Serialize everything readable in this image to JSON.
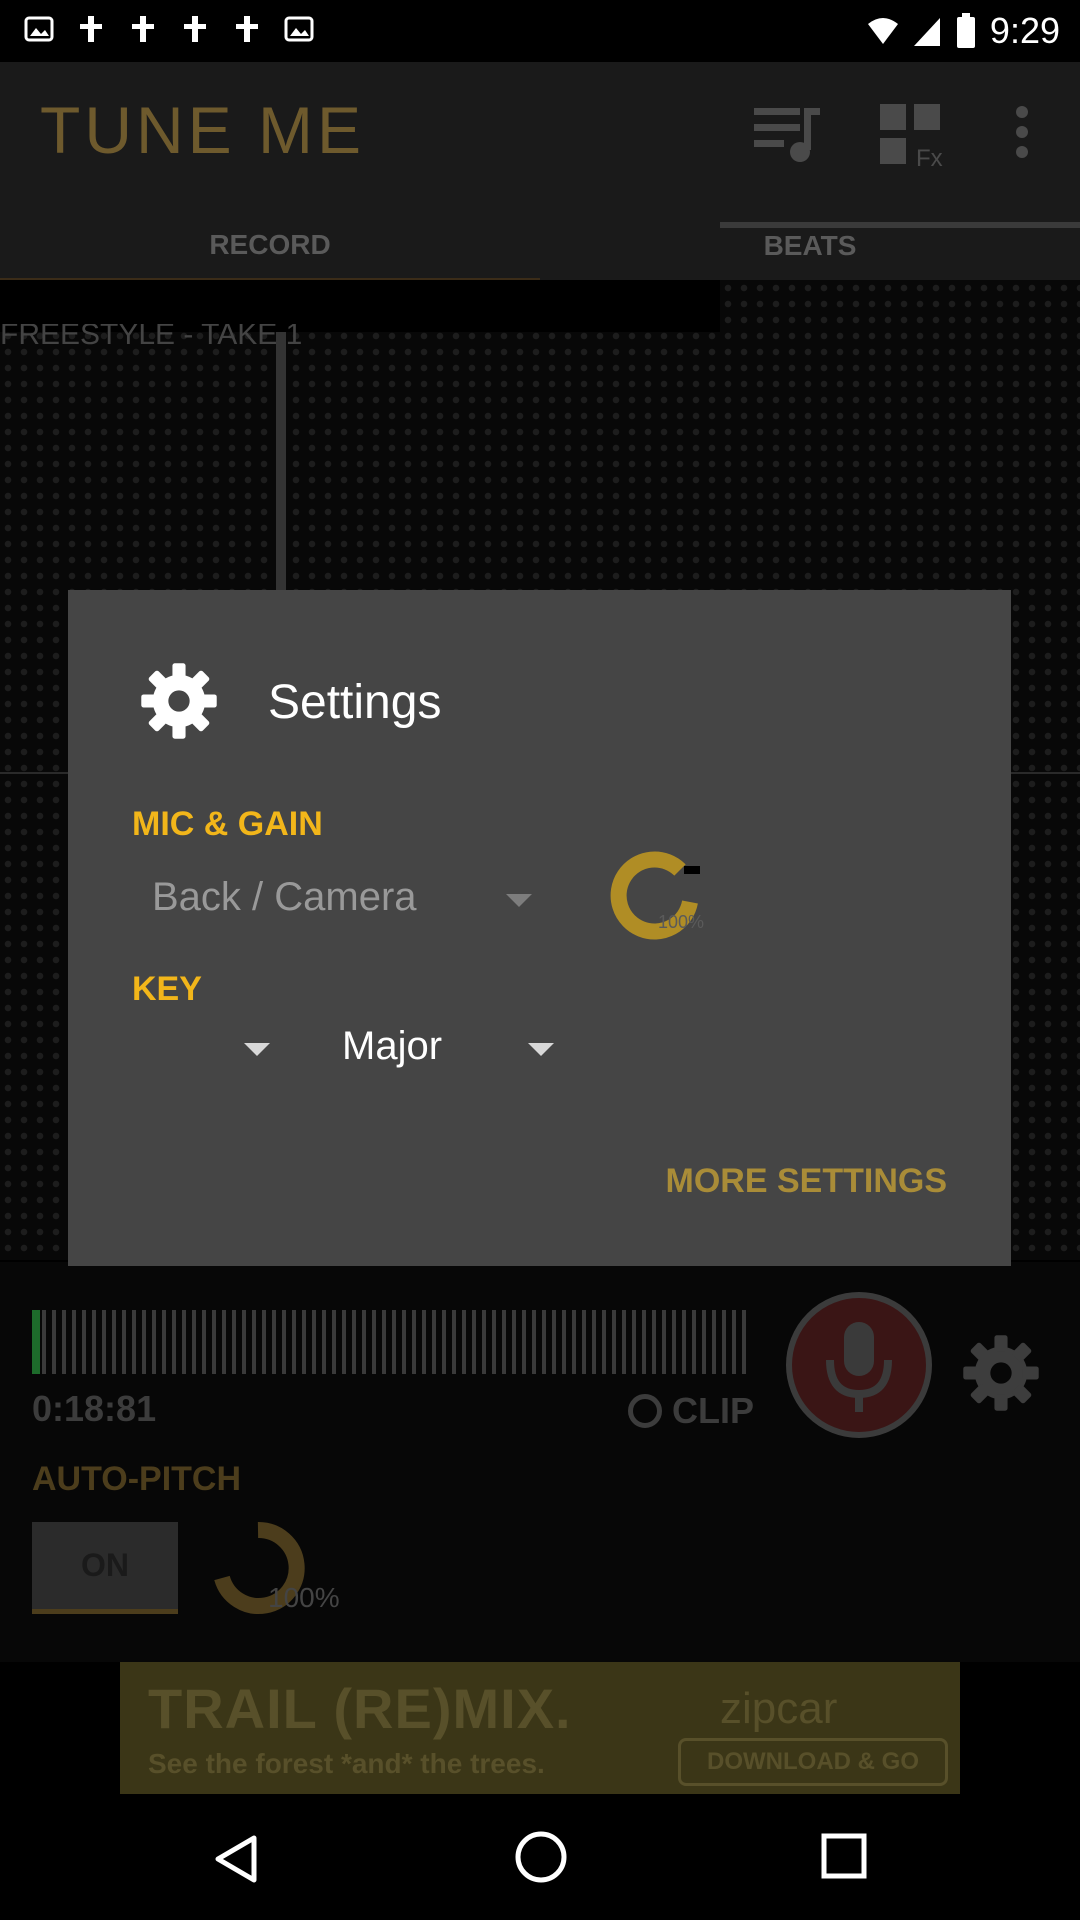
{
  "status_bar": {
    "time": "9:29"
  },
  "app": {
    "title": "TUNE ME"
  },
  "tabs": [
    {
      "label": "RECORD"
    },
    {
      "label": "BEATS"
    }
  ],
  "stage": {
    "label": "FREESTYLE - TAKE 1"
  },
  "controls": {
    "timer": "0:18:81",
    "clip_label": "CLIP",
    "autopitch_label": "AUTO-PITCH",
    "on_label": "ON",
    "pitch_strength": "100%",
    "pitch_strength_value": 1.0
  },
  "ad": {
    "headline": "TRAIL (RE)MIX.",
    "subline": "See the forest *and* the trees.",
    "brand": "zipcar",
    "cta": "DOWNLOAD & GO"
  },
  "dialog": {
    "title": "Settings",
    "mic_section_label": "MIC & GAIN",
    "mic_source": "Back / Camera",
    "gain_value": "100%",
    "key_section_label": "KEY",
    "key_note": "",
    "key_scale": "Major",
    "more_settings": "MORE SETTINGS"
  },
  "colors": {
    "accent_gold": "#f2b61a",
    "dialog_bg": "#454545",
    "mic_red": "#3a1515"
  }
}
